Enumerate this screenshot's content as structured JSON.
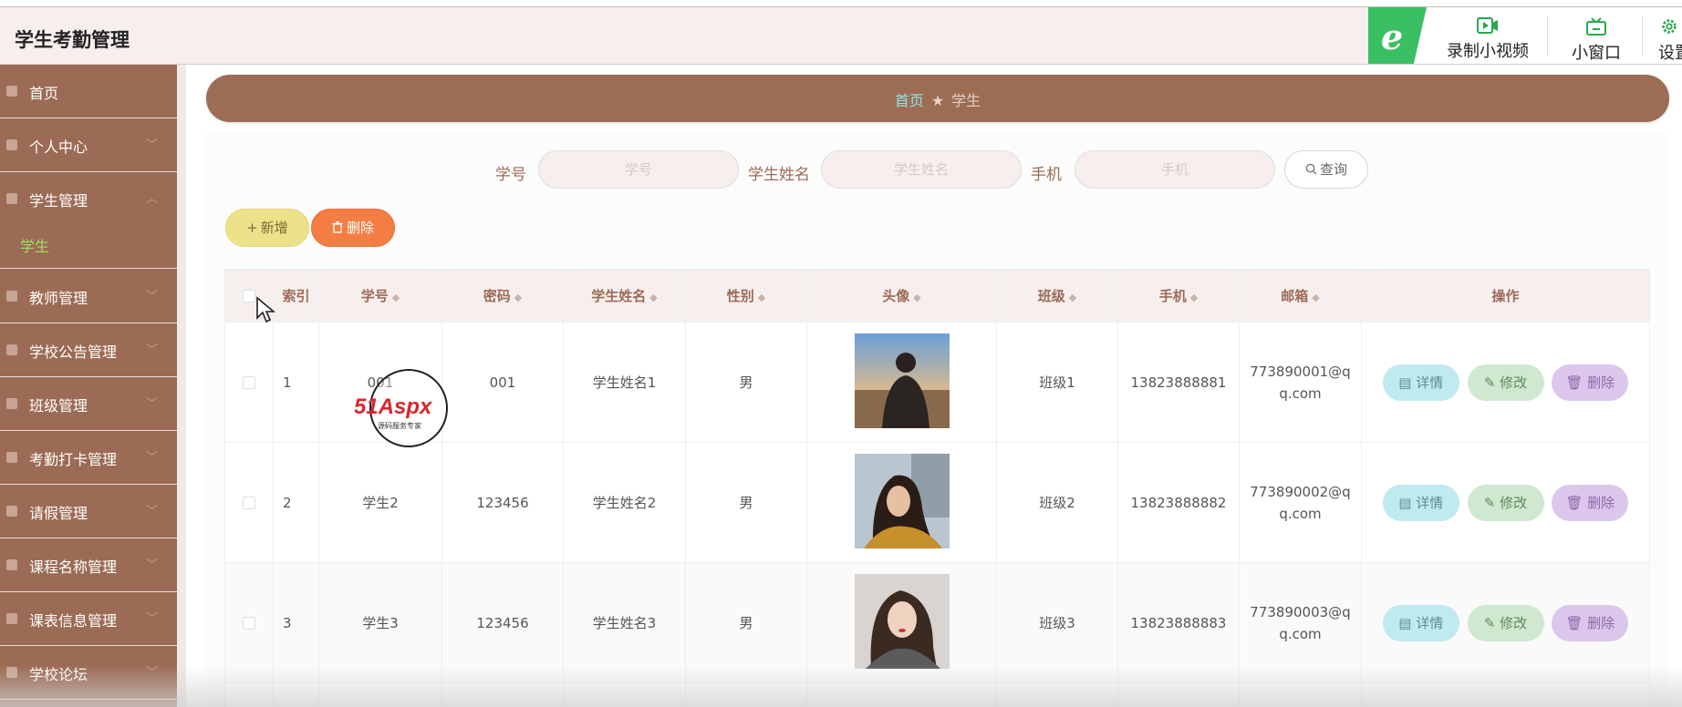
{
  "app": {
    "title": "学生考勤管理"
  },
  "recorder": {
    "badge_letter": "e",
    "record_label": "录制小视频",
    "window_label": "小窗口",
    "settings_label": "设置"
  },
  "sidebar": {
    "items": [
      {
        "label": "首页",
        "icon": "home-icon"
      },
      {
        "label": "个人中心",
        "icon": "user-icon"
      },
      {
        "label": "学生管理",
        "icon": "send-icon"
      },
      {
        "label": "教师管理",
        "icon": "chat-icon"
      },
      {
        "label": "学校公告管理",
        "icon": "mic-icon"
      },
      {
        "label": "班级管理",
        "icon": "bar-chart-icon"
      },
      {
        "label": "考勤打卡管理",
        "icon": "calendar-icon"
      },
      {
        "label": "请假管理",
        "icon": "leave-icon"
      },
      {
        "label": "课程名称管理",
        "icon": "clock-icon"
      },
      {
        "label": "课表信息管理",
        "icon": "shield-icon"
      },
      {
        "label": "学校论坛",
        "icon": "forum-icon"
      }
    ],
    "active_sub": "学生",
    "chevron_collapsed": "﹀",
    "chevron_expanded": "︿"
  },
  "breadcrumb": {
    "home": "首页",
    "separator": "★",
    "current": "学生"
  },
  "search": {
    "student_no_label": "学号",
    "student_no_placeholder": "学号",
    "student_name_label": "学生姓名",
    "student_name_placeholder": "学生姓名",
    "phone_label": "手机",
    "phone_placeholder": "手机",
    "query_label": "查询"
  },
  "actions": {
    "add_label": "新增",
    "delete_label": "删除"
  },
  "table": {
    "headers": [
      "索引",
      "学号",
      "密码",
      "学生姓名",
      "性别",
      "头像",
      "班级",
      "手机",
      "邮箱",
      "操作"
    ],
    "sort_symbol": "◆",
    "op_detail": "详情",
    "op_edit": "修改",
    "op_remove": "删除",
    "rows": [
      {
        "index": "1",
        "student_no": "001",
        "password": "001",
        "name": "学生姓名1",
        "gender": "男",
        "class": "班级1",
        "phone": "13823888881",
        "email": "773890001@qq.com",
        "avatar": "avatar-photo-1"
      },
      {
        "index": "2",
        "student_no": "学生2",
        "password": "123456",
        "name": "学生姓名2",
        "gender": "男",
        "class": "班级2",
        "phone": "13823888882",
        "email": "773890002@qq.com",
        "avatar": "avatar-photo-2"
      },
      {
        "index": "3",
        "student_no": "学生3",
        "password": "123456",
        "name": "学生姓名3",
        "gender": "男",
        "class": "班级3",
        "phone": "13823888883",
        "email": "773890003@qq.com",
        "avatar": "avatar-photo-3"
      }
    ]
  },
  "watermark": {
    "brand": "51Aspx",
    "tagline": "源码服务专家"
  },
  "colors": {
    "sidebar_bg": "#9c6b55",
    "accent_brown": "#9d6c55",
    "active_sub": "#9be15d",
    "add_btn": "#ede28a",
    "delete_btn": "#f47d43",
    "recorder_green": "#3bbf63"
  }
}
